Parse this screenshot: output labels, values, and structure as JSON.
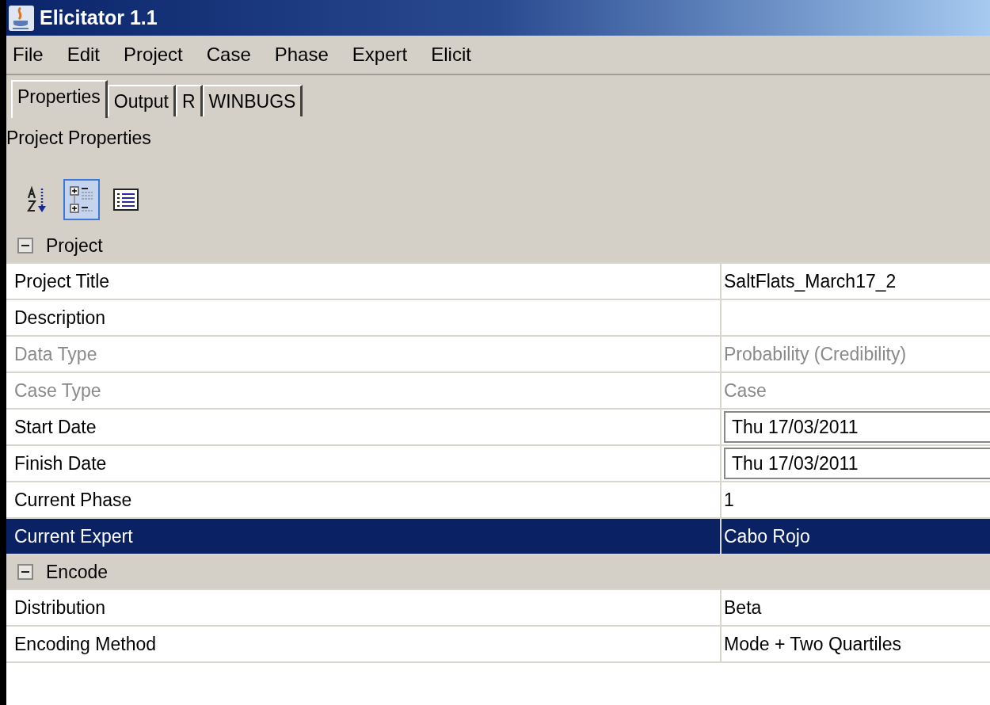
{
  "window": {
    "title": "Elicitator 1.1"
  },
  "menu": [
    "File",
    "Edit",
    "Project",
    "Case",
    "Phase",
    "Expert",
    "Elicit"
  ],
  "tabs": [
    {
      "label": "Properties",
      "selected": true
    },
    {
      "label": "Output",
      "selected": false
    },
    {
      "label": "R",
      "selected": false
    },
    {
      "label": "WINBUGS",
      "selected": false
    }
  ],
  "panel_title": "Project Properties",
  "toolbar": [
    {
      "kind": "sort",
      "selected": false
    },
    {
      "kind": "categorized",
      "selected": true
    },
    {
      "kind": "list",
      "selected": false
    }
  ],
  "sections": [
    {
      "title": "Project",
      "expanded": true,
      "rows": [
        {
          "name": "Project Title",
          "value": "SaltFlats_March17_2",
          "kind": "text",
          "disabled": false,
          "selected": false
        },
        {
          "name": "Description",
          "value": "",
          "kind": "text",
          "disabled": false,
          "selected": false
        },
        {
          "name": "Data Type",
          "value": "Probability (Credibility)",
          "kind": "text",
          "disabled": true,
          "selected": false
        },
        {
          "name": "Case Type",
          "value": "Case",
          "kind": "text",
          "disabled": true,
          "selected": false
        },
        {
          "name": "Start Date",
          "value": "Thu 17/03/2011",
          "kind": "date",
          "disabled": false,
          "selected": false
        },
        {
          "name": "Finish Date",
          "value": "Thu 17/03/2011",
          "kind": "date",
          "disabled": false,
          "selected": false
        },
        {
          "name": "Current Phase",
          "value": "1",
          "kind": "text",
          "disabled": false,
          "selected": false
        },
        {
          "name": "Current Expert",
          "value": "Cabo Rojo",
          "kind": "text",
          "disabled": false,
          "selected": true
        }
      ]
    },
    {
      "title": "Encode",
      "expanded": true,
      "rows": [
        {
          "name": "Distribution",
          "value": "Beta",
          "kind": "text",
          "disabled": false,
          "selected": false
        },
        {
          "name": "Encoding Method",
          "value": "Mode + Two Quartiles",
          "kind": "text",
          "disabled": false,
          "selected": false
        }
      ]
    }
  ]
}
